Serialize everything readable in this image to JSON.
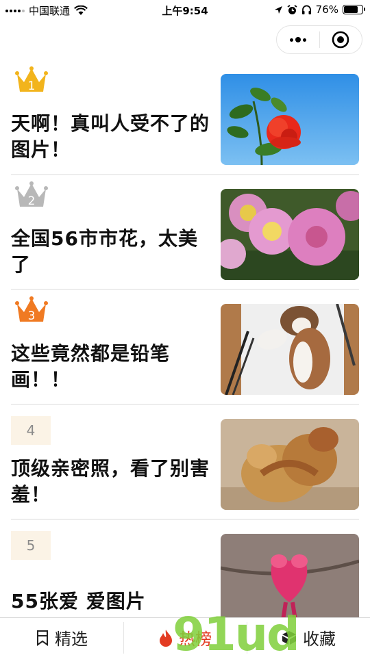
{
  "status_bar": {
    "carrier": "中国联通",
    "time": "上午9:54",
    "battery_percent": "76%",
    "battery_level": 0.76
  },
  "capsule": {
    "more_icon": "more-dots-icon",
    "close_icon": "target-circle-icon"
  },
  "list": [
    {
      "rank": "1",
      "rank_style": "gold-crown",
      "title": "天啊！真叫人受不了的图片！",
      "image": "red-rose-on-blue-sky"
    },
    {
      "rank": "2",
      "rank_style": "silver-crown",
      "title": "全国56市市花，太美了",
      "image": "pink-chrysanthemums"
    },
    {
      "rank": "3",
      "rank_style": "bronze-crown",
      "title": "这些竟然都是铅笔画！！",
      "image": "pencil-drawn-dog"
    },
    {
      "rank": "4",
      "rank_style": "plain-box",
      "title": "顶级亲密照，看了别害羞！",
      "image": "hugging-monkeys"
    },
    {
      "rank": "5",
      "rank_style": "plain-box",
      "title": "55张爱 爱图片",
      "image": "pink-parrots-heart"
    }
  ],
  "tabbar": {
    "tabs": [
      {
        "label": "精选",
        "icon": "bookmark-icon",
        "active": false
      },
      {
        "label": "热榜",
        "icon": "flame-icon",
        "active": true
      },
      {
        "label": "收藏",
        "icon": "box-icon",
        "active": false
      }
    ]
  },
  "watermark": "91ud",
  "colors": {
    "active_tab": "#e33b22",
    "gold": "#f2b41c",
    "silver": "#b8b8b8",
    "bronze": "#f07a22",
    "rank_box_bg": "#fbf3e6"
  }
}
